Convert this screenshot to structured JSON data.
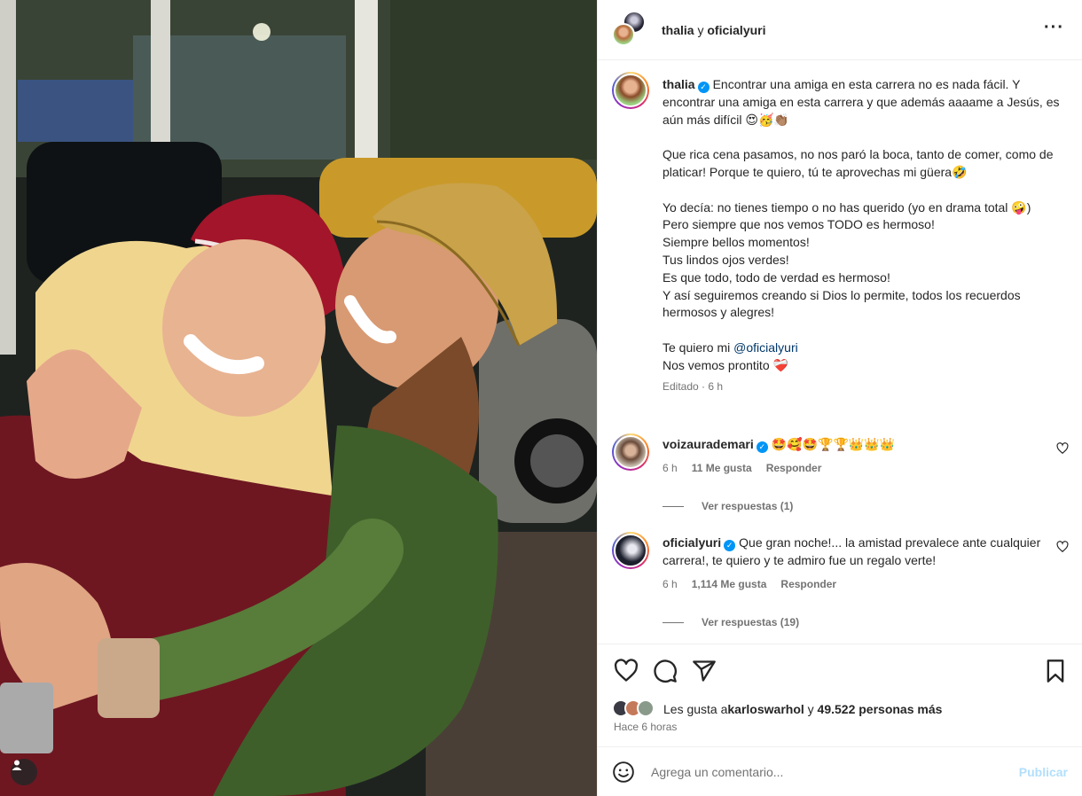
{
  "header": {
    "user1": "thalia",
    "connector": "y",
    "user2": "oficialyuri",
    "more_icon": "more-horizontal-icon"
  },
  "caption": {
    "username": "thalia",
    "verified": true,
    "p1": "Encontrar una amiga en esta carrera no es nada fácil. Y encontrar una amiga en esta carrera y que además aaaame a Jesús, es aún más difícil 😍🥳👏🏽",
    "p2": "Que rica cena pasamos, no nos paró la boca, tanto de comer, como de platicar! Porque te quiero, tú te aprovechas mi güera🤣",
    "p3": "Yo decía: no tienes tiempo o no has querido (yo en drama total 🤪)\nPero siempre que nos vemos TODO es hermoso!\nSiempre bellos momentos!\nTus lindos ojos verdes!\nEs que todo, todo de verdad es hermoso!\nY así seguiremos creando si Dios lo permite, todos los recuerdos hermosos y alegres!",
    "p4_prefix": "Te quiero mi ",
    "p4_mention": "@oficialyuri",
    "p5": "Nos vemos prontito ❤️‍🩹",
    "edited": "Editado · 6 h"
  },
  "comments": [
    {
      "username": "voizaurademari",
      "verified": true,
      "text": "🤩🥰🤩🏆🏆👑👑👑",
      "time": "6 h",
      "likes": "11 Me gusta",
      "reply": "Responder",
      "view_replies": "Ver respuestas (1)"
    },
    {
      "username": "oficialyuri",
      "verified": true,
      "text": "Que gran noche!... la amistad prevalece ante cualquier carrera!, te quiero y te admiro fue un regalo verte!",
      "time": "6 h",
      "likes": "1,114 Me gusta",
      "reply": "Responder",
      "view_replies": "Ver respuestas (19)"
    }
  ],
  "actions": {
    "icons": [
      "heart-icon",
      "comment-icon",
      "share-icon",
      "bookmark-icon"
    ],
    "likes_prefix": "Les gusta a ",
    "likes_user": "karloswarhol",
    "likes_connector": " y ",
    "likes_count": "49.522 personas más",
    "time_ago": "Hace 6 horas"
  },
  "add_comment": {
    "placeholder": "Agrega un comentario...",
    "post_label": "Publicar",
    "emoji_icon": "emoji-icon"
  },
  "colors": {
    "accent": "#0095f6",
    "post_disabled": "#b2dffc",
    "muted": "#737373",
    "mention": "#00376b"
  }
}
